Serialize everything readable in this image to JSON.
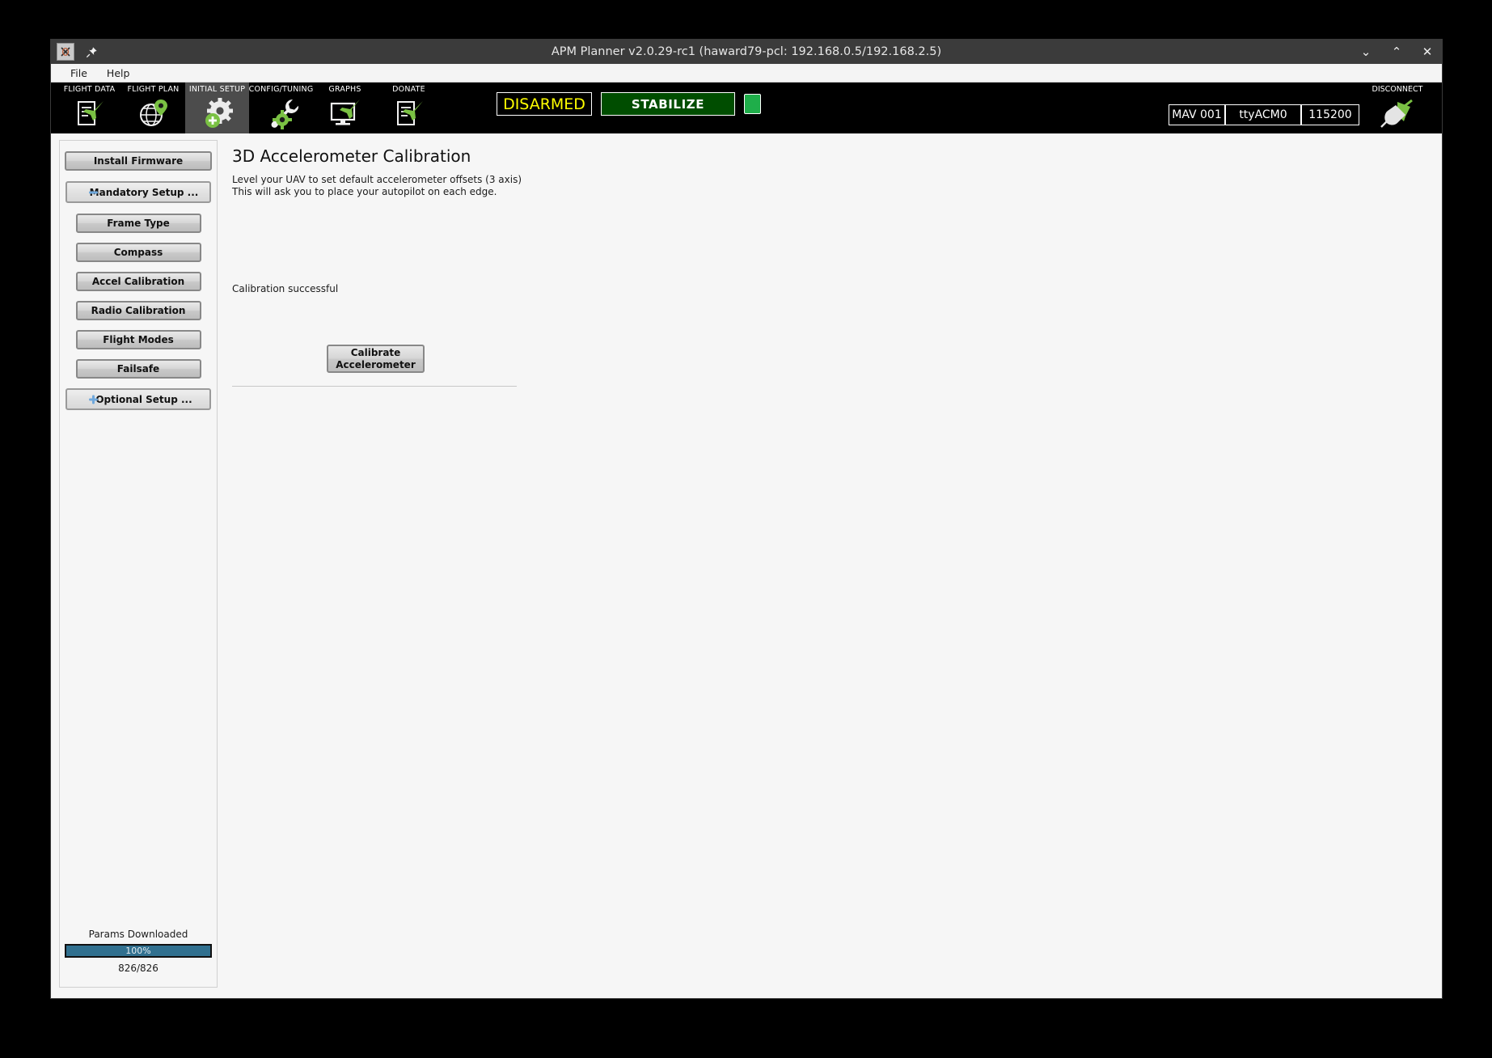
{
  "window": {
    "title": "APM Planner v2.0.29-rc1 (haward79-pcl: 192.168.0.5/192.168.2.5)",
    "app_icon": "x-window-icon",
    "pin_icon": "pin-icon",
    "controls": {
      "minimize": "⌄",
      "maximize": "⌃",
      "close": "✕"
    }
  },
  "menubar": {
    "items": [
      {
        "label": "File"
      },
      {
        "label": "Help"
      }
    ]
  },
  "toolbar": {
    "tabs": [
      {
        "label": "FLIGHT DATA",
        "icon": "document-plane-icon",
        "active": false
      },
      {
        "label": "FLIGHT PLAN",
        "icon": "globe-marker-icon",
        "active": false
      },
      {
        "label": "INITIAL SETUP",
        "icon": "gear-plus-icon",
        "active": true
      },
      {
        "label": "CONFIG/TUNING",
        "icon": "wrench-gear-icon",
        "active": false
      },
      {
        "label": "GRAPHS",
        "icon": "monitor-plane-icon",
        "active": false
      },
      {
        "label": "DONATE",
        "icon": "document-plane-icon",
        "active": false
      }
    ],
    "status": {
      "arm_state": "DISARMED",
      "arm_color": "#ffff00",
      "flight_mode": "STABILIZE",
      "flight_mode_bg": "#004d00",
      "link_led_color": "#1fae4a"
    },
    "connection": {
      "mav_id": "MAV 001",
      "port": "ttyACM0",
      "baud": "115200",
      "disconnect_label": "DISCONNECT",
      "disconnect_icon": "plug-icon"
    }
  },
  "sidebar": {
    "install_firmware": "Install Firmware",
    "groups": [
      {
        "label": "Mandatory Setup ...",
        "icon": "minus-icon",
        "icon_color": "#6699cc",
        "expanded": true
      },
      {
        "label": "Optional Setup ...",
        "icon": "plus-icon",
        "icon_color": "#6699cc",
        "expanded": false
      }
    ],
    "mandatory_items": [
      {
        "label": "Frame Type"
      },
      {
        "label": "Compass"
      },
      {
        "label": "Accel Calibration"
      },
      {
        "label": "Radio Calibration"
      },
      {
        "label": "Flight Modes"
      },
      {
        "label": "Failsafe"
      }
    ],
    "params": {
      "label": "Params Downloaded",
      "percent_text": "100%",
      "percent_value": 100,
      "count": "826/826",
      "bar_color": "#31708f"
    }
  },
  "main": {
    "title": "3D Accelerometer Calibration",
    "description_line1": "Level your UAV to set default accelerometer offsets (3 axis)",
    "description_line2": "This will ask you to place your autopilot on each edge.",
    "status_message": "Calibration successful",
    "calibrate_button_line1": "Calibrate",
    "calibrate_button_line2": "Accelerometer"
  }
}
